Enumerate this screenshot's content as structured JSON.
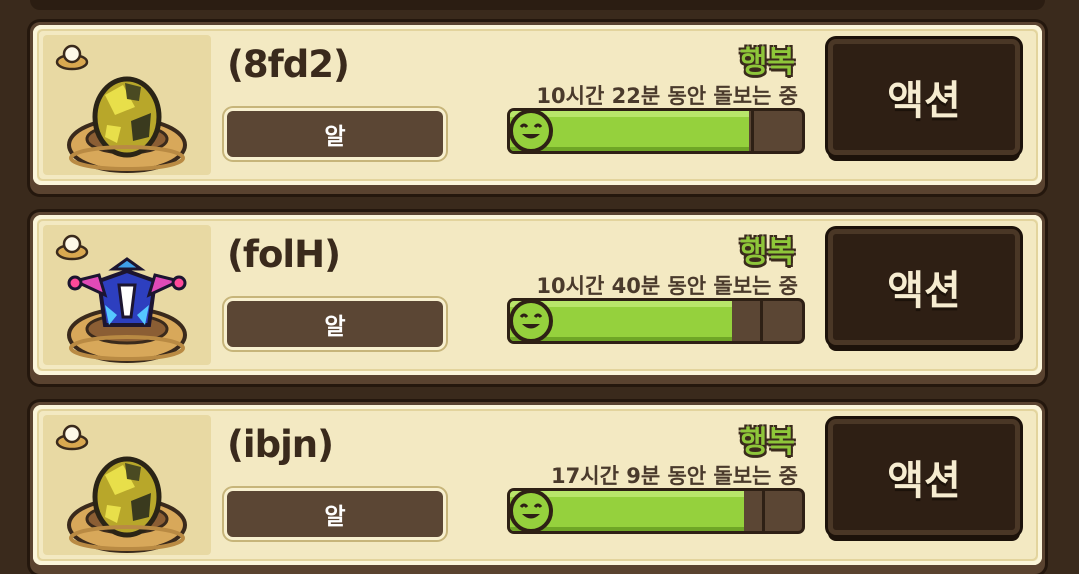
{
  "pets": [
    {
      "name": "(8fd2)",
      "type": "알",
      "mood": "행복",
      "care_time": "10시간 22분 동안 돌보는 중",
      "happiness": 0.82,
      "creature": "yellow-egg",
      "action_label": "액션"
    },
    {
      "name": "(folH)",
      "type": "알",
      "mood": "행복",
      "care_time": "10시간 40분 동안 돌보는 중",
      "happiness": 0.76,
      "creature": "jester-egg",
      "action_label": "액션"
    },
    {
      "name": "(ibjn)",
      "type": "알",
      "mood": "행복",
      "care_time": "17시간 9분 동안 돌보는 중",
      "happiness": 0.8,
      "creature": "yellow-egg",
      "action_label": "액션"
    }
  ],
  "colors": {
    "card_bg": "#f3e9c2",
    "bar_fill": "#95d13d",
    "mood_text": "#8ec63a",
    "action_bg": "#2e1f14"
  }
}
